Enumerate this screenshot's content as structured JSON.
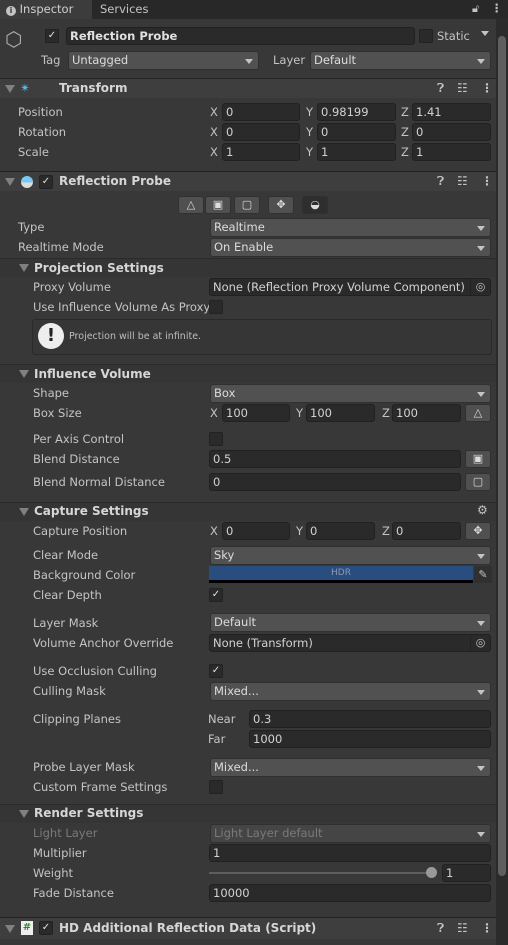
{
  "tabs": [
    {
      "label": "Inspector",
      "active": true
    },
    {
      "label": "Services",
      "active": false
    }
  ],
  "object": {
    "name": "Reflection Probe",
    "active": true,
    "static_label": "Static",
    "static": false,
    "tag_label": "Tag",
    "tag": "Untagged",
    "layer_label": "Layer",
    "layer": "Default"
  },
  "transform": {
    "title": "Transform",
    "rows": [
      {
        "label": "Position",
        "x": "0",
        "y": "0.98199",
        "z": "1.41"
      },
      {
        "label": "Rotation",
        "x": "0",
        "y": "0",
        "z": "0"
      },
      {
        "label": "Scale",
        "x": "1",
        "y": "1",
        "z": "1"
      }
    ]
  },
  "axes": {
    "x": "X",
    "y": "Y",
    "z": "Z"
  },
  "probe": {
    "title": "Reflection Probe",
    "enabled": true,
    "type_label": "Type",
    "type": "Realtime",
    "mode_label": "Realtime Mode",
    "mode": "On Enable",
    "projection": {
      "title": "Projection Settings",
      "proxy_label": "Proxy Volume",
      "proxy": "None (Reflection Proxy Volume Component)",
      "use_influence_label": "Use Influence Volume As Proxy",
      "use_influence": false,
      "help": "Projection will be at infinite."
    },
    "influence": {
      "title": "Influence Volume",
      "shape_label": "Shape",
      "shape": "Box",
      "box_label": "Box Size",
      "box": {
        "x": "100",
        "y": "100",
        "z": "100"
      },
      "per_axis_label": "Per Axis Control",
      "per_axis": false,
      "blend_label": "Blend Distance",
      "blend": "0.5",
      "blend_normal_label": "Blend Normal Distance",
      "blend_normal": "0"
    },
    "capture": {
      "title": "Capture Settings",
      "pos_label": "Capture Position",
      "pos": {
        "x": "0",
        "y": "0",
        "z": "0"
      },
      "clear_mode_label": "Clear Mode",
      "clear_mode": "Sky",
      "bg_label": "Background Color",
      "bg_color": "#2a4d7f",
      "bg_hdr": "HDR",
      "clear_depth_label": "Clear Depth",
      "clear_depth": true,
      "layer_mask_label": "Layer Mask",
      "layer_mask": "Default",
      "anchor_label": "Volume Anchor Override",
      "anchor": "None (Transform)",
      "occlusion_label": "Use Occlusion Culling",
      "occlusion": true,
      "culling_label": "Culling Mask",
      "culling": "Mixed...",
      "clip_label": "Clipping Planes",
      "near_label": "Near",
      "near": "0.3",
      "far_label": "Far",
      "far": "1000",
      "probe_mask_label": "Probe Layer Mask",
      "probe_mask": "Mixed...",
      "custom_frame_label": "Custom Frame Settings",
      "custom_frame": false
    },
    "render": {
      "title": "Render Settings",
      "light_layer_label": "Light Layer",
      "light_layer": "Light Layer default",
      "multiplier_label": "Multiplier",
      "multiplier": "1",
      "weight_label": "Weight",
      "weight": "1",
      "weight_fraction": 1.0,
      "fade_label": "Fade Distance",
      "fade": "10000"
    }
  },
  "script": {
    "title": "HD Additional Reflection Data (Script)",
    "enabled": true
  }
}
